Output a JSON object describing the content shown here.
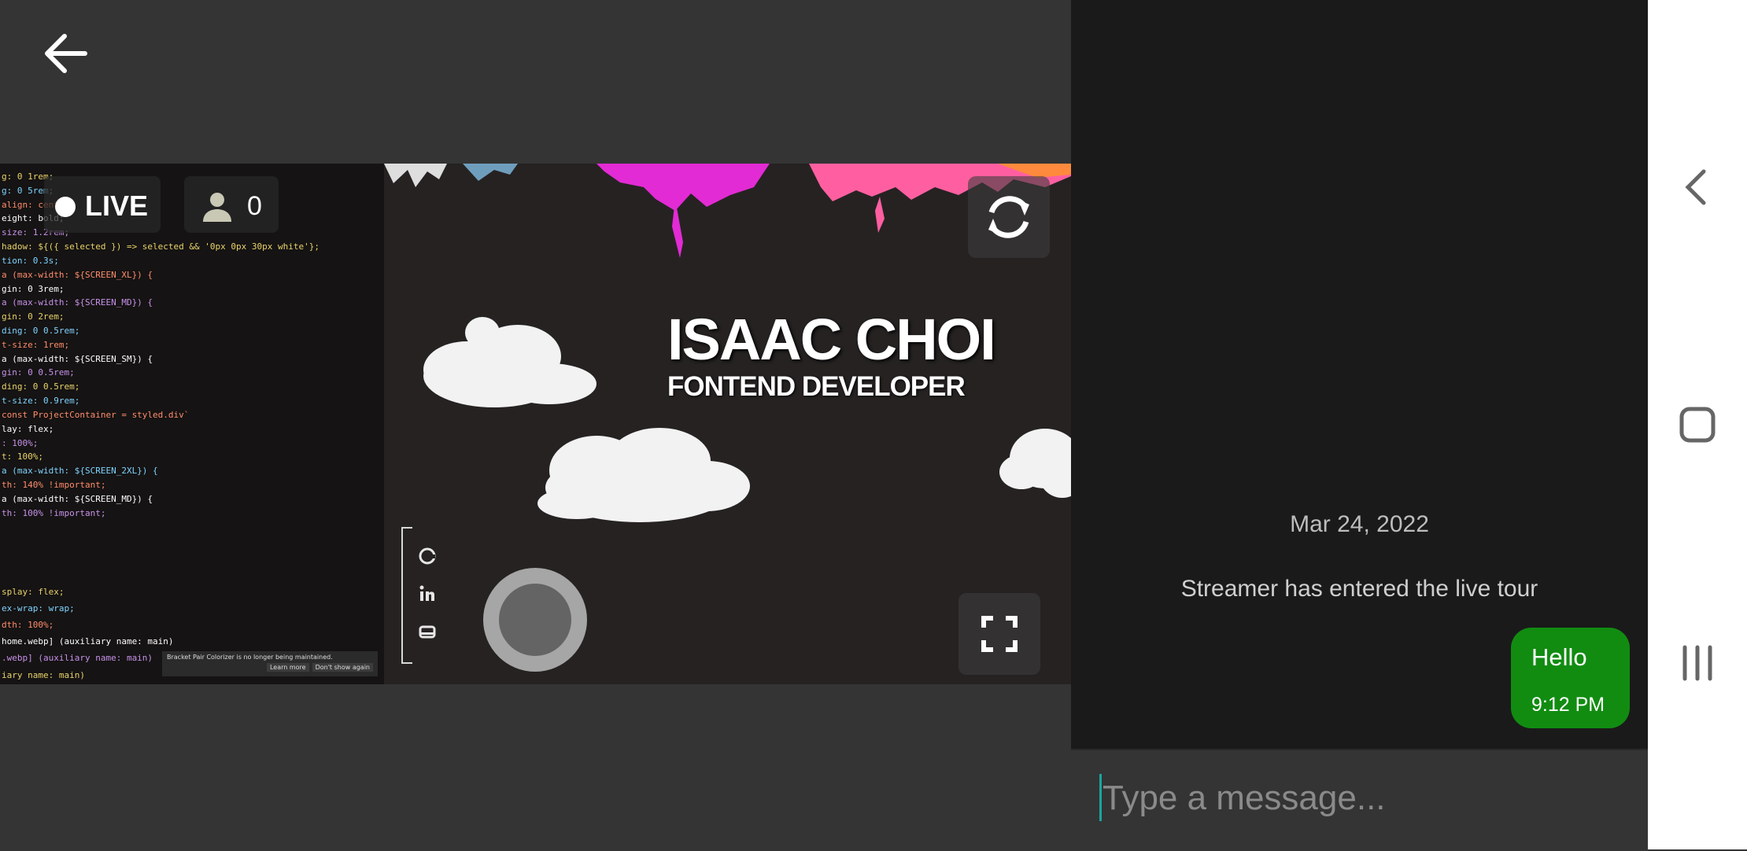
{
  "header": {
    "back_icon": "arrow-left-icon"
  },
  "stream": {
    "live_label": "LIVE",
    "viewer_count": "0",
    "viewer_icon": "person-icon",
    "switch_icon": "camera-switch-icon",
    "fullscreen_icon": "fullscreen-icon",
    "record_icon": "record-button",
    "title_name": "ISAAC CHOI",
    "title_role": "FONTEND DEVELOPER",
    "social_icons": [
      "github-icon",
      "linkedin-icon",
      "contact-icon"
    ],
    "code_lines": [
      "g: 0 1rem;",
      "g: 0 5rem;",
      "align: center;",
      "eight: bold;",
      "size: 1.2rem;",
      "hadow: ${({ selected }) => selected && '0px 0px 30px white'};",
      "tion: 0.3s;",
      "a (max-width: ${SCREEN_XL}) {",
      "gin: 0 3rem;",
      "a (max-width: ${SCREEN_MD}) {",
      "gin: 0 2rem;",
      "ding: 0 0.5rem;",
      "t-size: 1rem;",
      "a (max-width: ${SCREEN_SM}) {",
      "gin: 0 0.5rem;",
      "ding: 0 0.5rem;",
      "t-size: 0.9rem;",
      "const ProjectContainer = styled.div`",
      "lay: flex;",
      ": 100%;",
      "t: 100%;",
      "a (max-width: ${SCREEN_2XL}) {",
      "th: 140% !important;",
      "a (max-width: ${SCREEN_MD}) {",
      "th: 100% !important;",
      "splay: flex;",
      "ex-wrap: wrap;",
      "dth: 100%;",
      "home.webp] (auxiliary name: main)",
      ".webp] (auxiliary name: main)",
      "iary name: main)"
    ],
    "notification": "Bracket Pair Colorizer is no longer being maintained.",
    "notification_learn": "Learn more",
    "notification_dismiss": "Don't show again"
  },
  "chat": {
    "date": "Mar 24, 2022",
    "system_message": "Streamer has entered the live tour",
    "messages": [
      {
        "text": "Hello",
        "time": "9:12 PM"
      }
    ],
    "input_placeholder": "Type a message..."
  },
  "nav": {
    "back_icon": "nav-back-icon",
    "home_icon": "nav-home-icon",
    "recents_icon": "nav-recents-icon"
  },
  "colors": {
    "bubble": "#118c11",
    "caret": "#19a6a0",
    "chat_bg": "#1a1a1a",
    "page_bg": "#343434"
  }
}
